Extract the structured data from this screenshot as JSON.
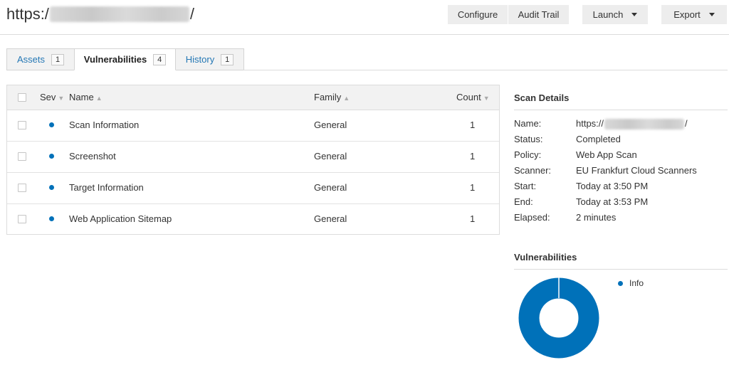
{
  "header": {
    "url_prefix": "https:/",
    "url_suffix": "/",
    "configure_label": "Configure",
    "audit_trail_label": "Audit Trail",
    "launch_label": "Launch",
    "export_label": "Export"
  },
  "tabs": [
    {
      "label": "Assets",
      "count": "1"
    },
    {
      "label": "Vulnerabilities",
      "count": "4"
    },
    {
      "label": "History",
      "count": "1"
    }
  ],
  "table": {
    "columns": {
      "sev": "Sev",
      "name": "Name",
      "family": "Family",
      "count": "Count"
    },
    "rows": [
      {
        "name": "Scan Information",
        "family": "General",
        "count": "1"
      },
      {
        "name": "Screenshot",
        "family": "General",
        "count": "1"
      },
      {
        "name": "Target Information",
        "family": "General",
        "count": "1"
      },
      {
        "name": "Web Application Sitemap",
        "family": "General",
        "count": "1"
      }
    ]
  },
  "scan_details": {
    "heading": "Scan Details",
    "name_label": "Name:",
    "name_value": "https://",
    "name_suffix": "/",
    "status_label": "Status:",
    "status_value": "Completed",
    "policy_label": "Policy:",
    "policy_value": "Web App Scan",
    "scanner_label": "Scanner:",
    "scanner_value": "EU Frankfurt Cloud Scanners",
    "start_label": "Start:",
    "start_value": "Today at 3:50 PM",
    "end_label": "End:",
    "end_value": "Today at 3:53 PM",
    "elapsed_label": "Elapsed:",
    "elapsed_value": "2 minutes"
  },
  "vulnerabilities_panel": {
    "heading": "Vulnerabilities",
    "legend_label": "Info"
  },
  "colors": {
    "info": "#0071b9",
    "link": "#2578b5"
  },
  "icons": [
    "checkbox-icon",
    "sort-arrow-icon",
    "caret-down-icon",
    "severity-dot-icon"
  ]
}
